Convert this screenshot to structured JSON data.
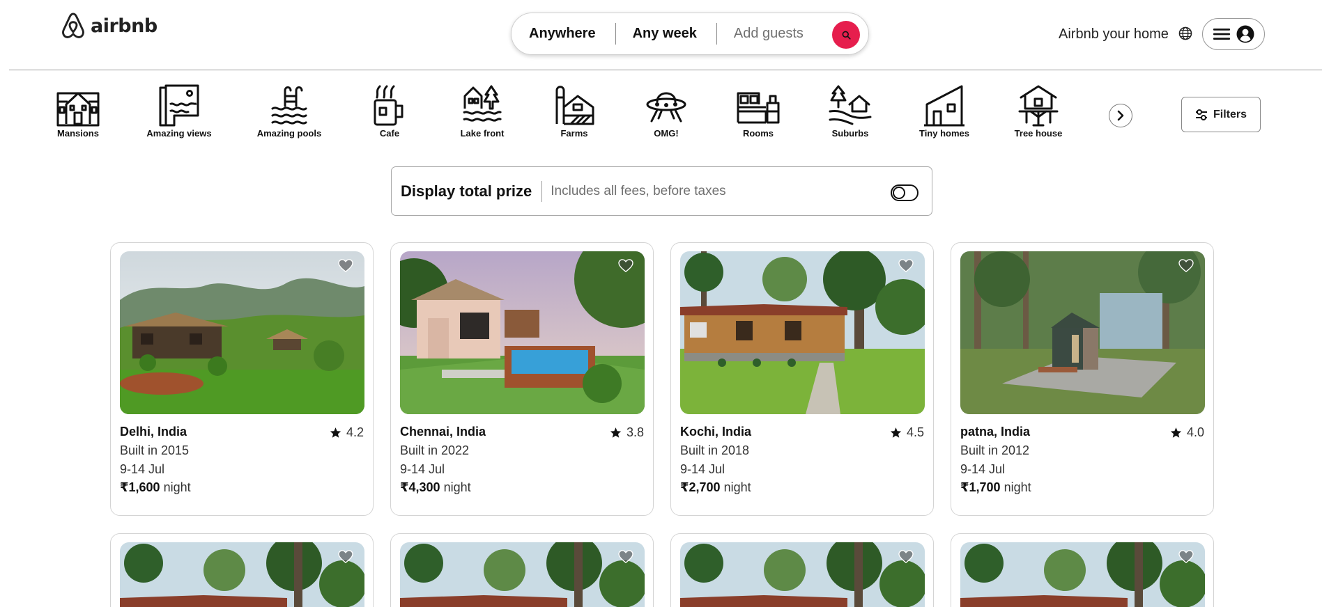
{
  "header": {
    "logo_text": "airbnb",
    "search": {
      "location": "Anywhere",
      "dates": "Any week",
      "guests": "Add guests"
    },
    "host_link": "Airbnb your home",
    "brand_color": "#e61e4d"
  },
  "categories": [
    {
      "label": "Mansions",
      "icon": "mansion-icon"
    },
    {
      "label": "Amazing views",
      "icon": "amazing-views-icon"
    },
    {
      "label": "Amazing pools",
      "icon": "pool-icon"
    },
    {
      "label": "Cafe",
      "icon": "cafe-icon"
    },
    {
      "label": "Lake front",
      "icon": "lake-front-icon"
    },
    {
      "label": "Farms",
      "icon": "farm-icon"
    },
    {
      "label": "OMG!",
      "icon": "ufo-icon"
    },
    {
      "label": "Rooms",
      "icon": "room-icon"
    },
    {
      "label": "Suburbs",
      "icon": "suburb-icon"
    },
    {
      "label": "Tiny homes",
      "icon": "tiny-home-icon"
    },
    {
      "label": "Tree house",
      "icon": "tree-house-icon"
    }
  ],
  "filters_label": "Filters",
  "price_toggle": {
    "title": "Display total prize",
    "subtitle": "Includes all fees, before taxes",
    "enabled": false
  },
  "listings": [
    {
      "location": "Delhi, India",
      "rating": "4.2",
      "built": "Built in 2015",
      "dates": "9-14 Jul",
      "price": "₹1,600",
      "unit": "night"
    },
    {
      "location": "Chennai, India",
      "rating": "3.8",
      "built": "Built in 2022",
      "dates": "9-14 Jul",
      "price": "₹4,300",
      "unit": "night"
    },
    {
      "location": "Kochi, India",
      "rating": "4.5",
      "built": "Built in 2018",
      "dates": "9-14 Jul",
      "price": "₹2,700",
      "unit": "night"
    },
    {
      "location": "patna, India",
      "rating": "4.0",
      "built": "Built in 2012",
      "dates": "9-14 Jul",
      "price": "₹1,700",
      "unit": "night"
    }
  ]
}
